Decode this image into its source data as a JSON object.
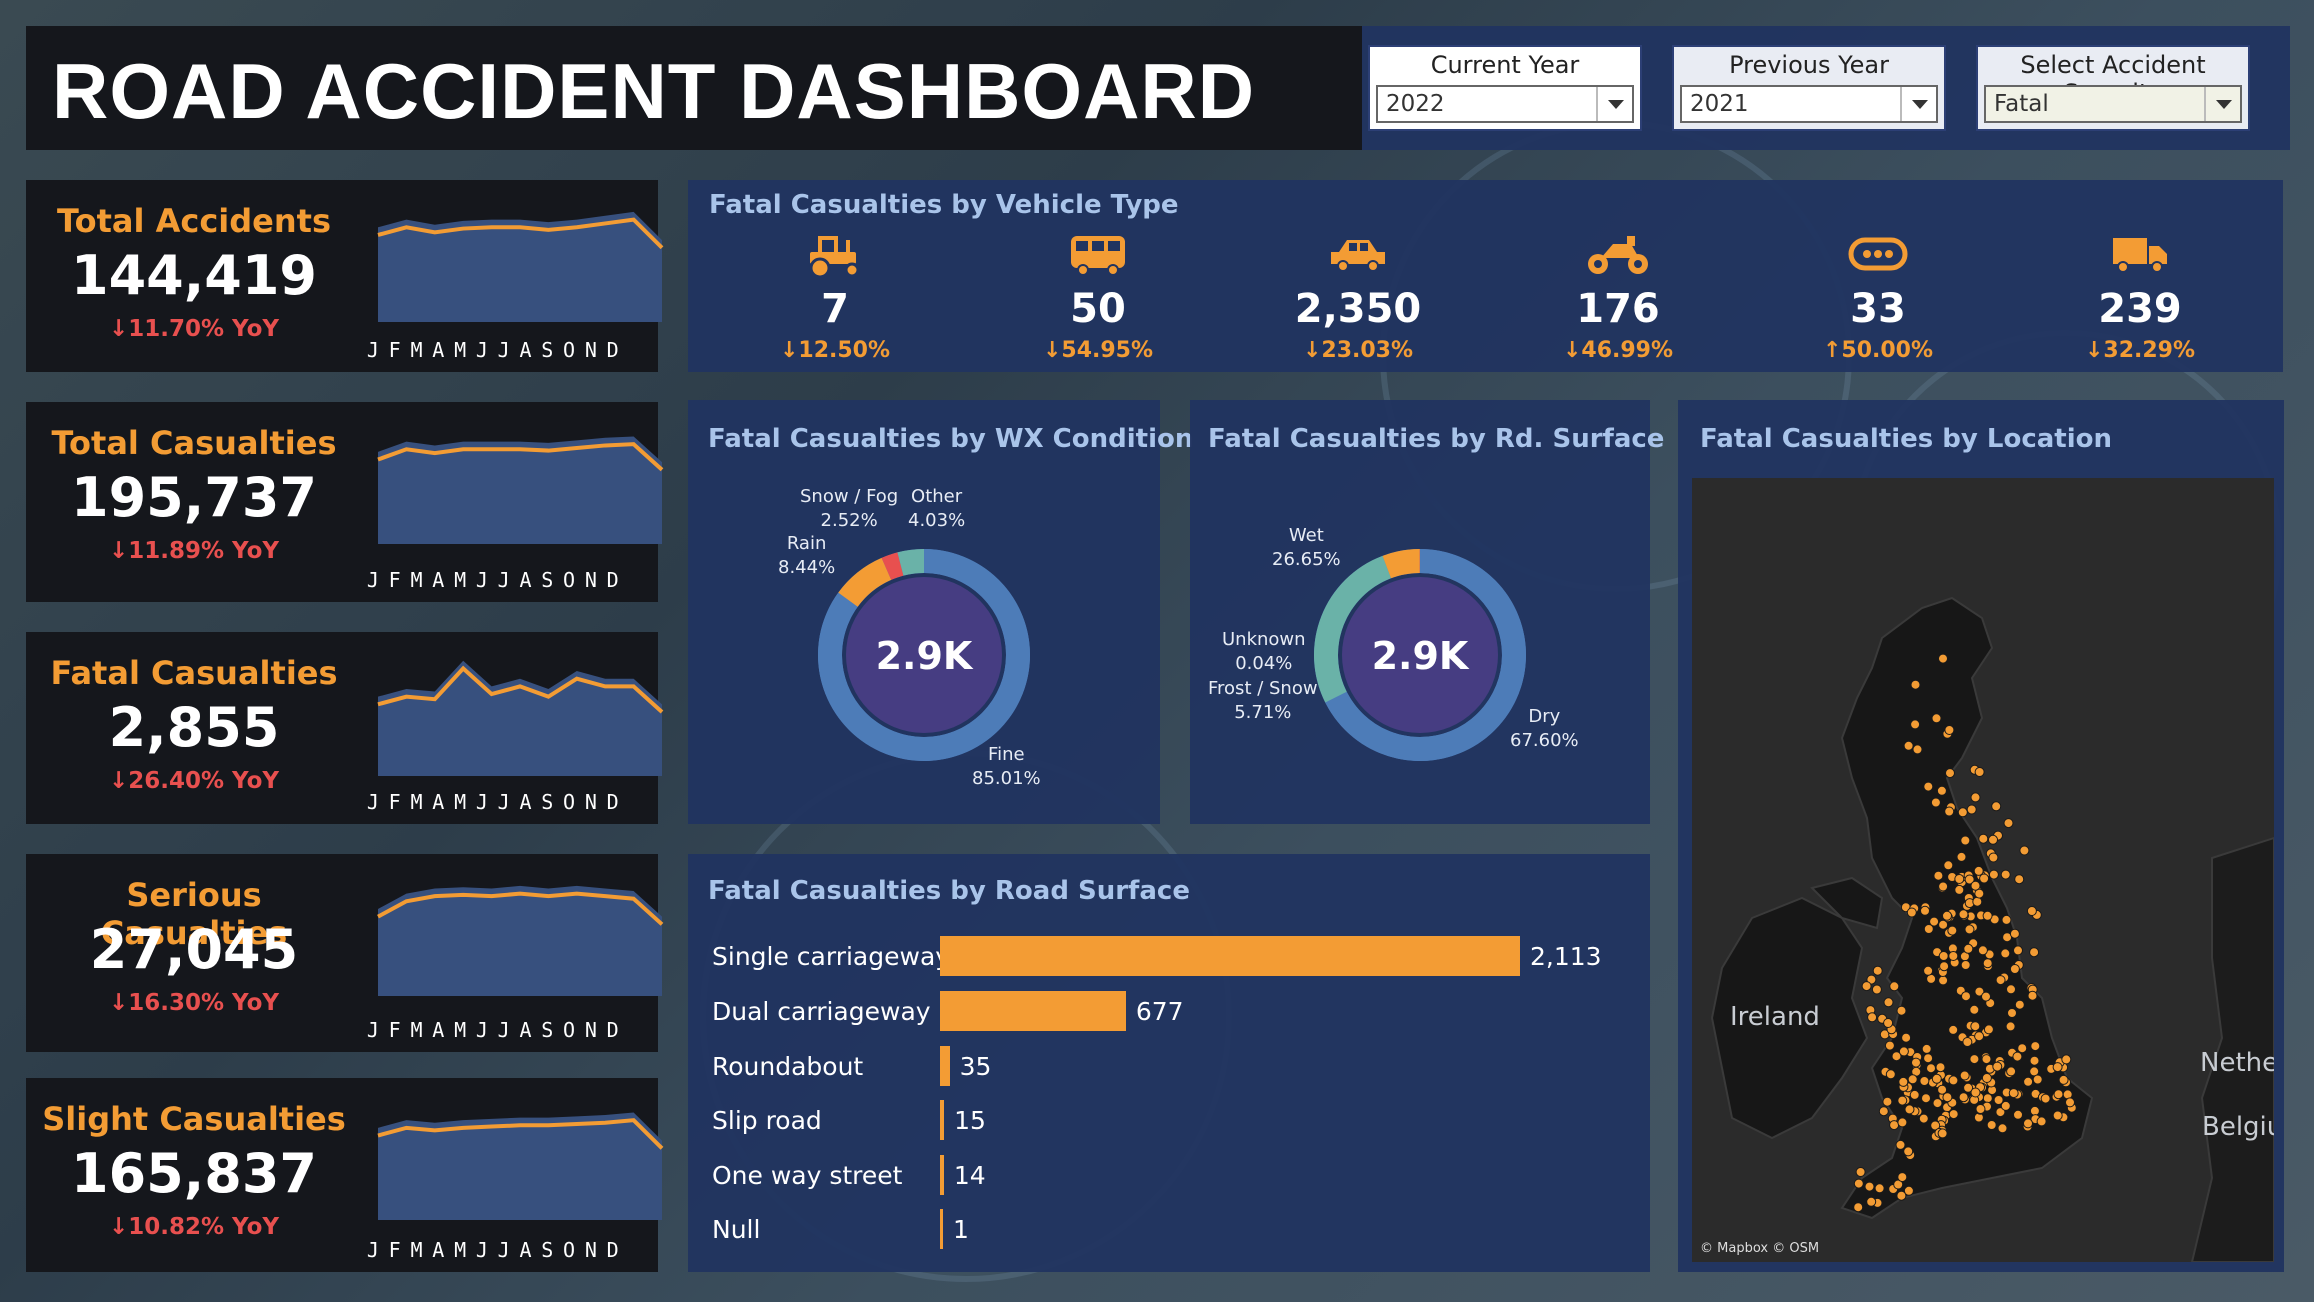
{
  "header": {
    "title": "ROAD ACCIDENT DASHBOARD",
    "filters": [
      {
        "label": "Current Year",
        "value": "2022"
      },
      {
        "label": "Previous Year",
        "value": "2021"
      },
      {
        "label": "Select Accident Severity",
        "value": "Fatal"
      }
    ]
  },
  "kpis": [
    {
      "title": "Total Accidents",
      "value": "144,419",
      "yoy": "↓11.70% YoY",
      "trend": [
        68,
        74,
        70,
        73,
        74,
        74,
        72,
        74,
        77,
        80,
        58
      ],
      "months": [
        "J",
        "F",
        "M",
        "A",
        "M",
        "J",
        "J",
        "A",
        "S",
        "O",
        "N",
        "D"
      ]
    },
    {
      "title": "Total Casualties",
      "value": "195,737",
      "yoy": "↓11.89% YoY",
      "trend": [
        66,
        74,
        71,
        74,
        74,
        74,
        73,
        75,
        77,
        78,
        58
      ],
      "months": [
        "J",
        "F",
        "M",
        "A",
        "M",
        "J",
        "J",
        "A",
        "S",
        "O",
        "N",
        "D"
      ]
    },
    {
      "title": "Fatal Casualties",
      "value": "2,855",
      "yoy": "↓26.40% YoY",
      "trend": [
        56,
        62,
        60,
        84,
        64,
        70,
        62,
        76,
        70,
        70,
        50
      ],
      "months": [
        "J",
        "F",
        "M",
        "A",
        "M",
        "J",
        "J",
        "A",
        "S",
        "O",
        "N",
        "D"
      ]
    },
    {
      "title": "Serious Casualties",
      "value": "27,045",
      "yoy": "↓16.30% YoY",
      "trend": [
        62,
        74,
        78,
        79,
        78,
        80,
        78,
        80,
        78,
        76,
        56
      ],
      "months": [
        "J",
        "F",
        "M",
        "A",
        "M",
        "J",
        "J",
        "A",
        "S",
        "O",
        "N",
        "D"
      ]
    },
    {
      "title": "Slight Casualties",
      "value": "165,837",
      "yoy": "↓10.82% YoY",
      "trend": [
        66,
        72,
        70,
        72,
        73,
        74,
        74,
        75,
        76,
        78,
        56
      ],
      "months": [
        "J",
        "F",
        "M",
        "A",
        "M",
        "J",
        "J",
        "A",
        "S",
        "O",
        "N",
        "D"
      ]
    }
  ],
  "vehicle_panel": {
    "title": "Fatal Casualties by Vehicle Type",
    "items": [
      {
        "icon": "tractor-icon",
        "value": "7",
        "change": "↓12.50%"
      },
      {
        "icon": "bus-icon",
        "value": "50",
        "change": "↓54.95%"
      },
      {
        "icon": "car-icon",
        "value": "2,350",
        "change": "↓23.03%"
      },
      {
        "icon": "motorcycle-icon",
        "value": "176",
        "change": "↓46.99%"
      },
      {
        "icon": "other-vehicle-icon",
        "value": "33",
        "change": "↑50.00%"
      },
      {
        "icon": "truck-icon",
        "value": "239",
        "change": "↓32.29%"
      }
    ]
  },
  "wx_panel": {
    "title": "Fatal Casualties by WX Condition",
    "center": "2.9K",
    "labels": {
      "snow_fog": "Snow / Fog",
      "snow_fog_pct": "2.52%",
      "other": "Other",
      "other_pct": "4.03%",
      "rain": "Rain",
      "rain_pct": "8.44%",
      "fine": "Fine",
      "fine_pct": "85.01%"
    }
  },
  "surface_panel": {
    "title": "Fatal Casualties by Rd. Surface",
    "center": "2.9K",
    "labels": {
      "wet": "Wet",
      "wet_pct": "26.65%",
      "unknown": "Unknown",
      "unknown_pct": "0.04%",
      "frost": "Frost / Snow",
      "frost_pct": "5.71%",
      "dry": "Dry",
      "dry_pct": "67.60%"
    }
  },
  "road_panel": {
    "title": "Fatal Casualties by Road Surface"
  },
  "map_panel": {
    "title": "Fatal Casualties by Location",
    "labels": {
      "ireland": "Ireland",
      "nether": "Nethe",
      "belgium": "Belgiu"
    },
    "credit": "© Mapbox © OSM"
  },
  "colors": {
    "accent": "#f39c34",
    "negative": "#e8504f",
    "panel": "#213460",
    "donut_base": "#4d7cb8",
    "donut_center": "#463d82",
    "teal": "#6ab2a8"
  },
  "chart_data": [
    {
      "type": "pie",
      "title": "Fatal Casualties by WX Condition",
      "categories": [
        "Fine",
        "Rain",
        "Snow / Fog",
        "Other"
      ],
      "values": [
        85.01,
        8.44,
        2.52,
        4.03
      ],
      "center_label": "2.9K"
    },
    {
      "type": "pie",
      "title": "Fatal Casualties by Rd. Surface",
      "categories": [
        "Dry",
        "Wet",
        "Frost / Snow",
        "Unknown"
      ],
      "values": [
        67.6,
        26.65,
        5.71,
        0.04
      ],
      "center_label": "2.9K"
    },
    {
      "type": "bar",
      "title": "Fatal Casualties by Road Surface",
      "categories": [
        "Single carriageway",
        "Dual carriageway",
        "Roundabout",
        "Slip road",
        "One way street",
        "Null"
      ],
      "values": [
        2113,
        677,
        35,
        15,
        14,
        1
      ],
      "value_labels": [
        "2,113",
        "677",
        "35",
        "15",
        "14",
        "1"
      ]
    },
    {
      "type": "line",
      "title": "Total Accidents",
      "categories": [
        "J",
        "F",
        "M",
        "A",
        "M",
        "J",
        "J",
        "A",
        "S",
        "O",
        "N",
        "D"
      ],
      "values": [
        68,
        74,
        70,
        73,
        74,
        74,
        72,
        74,
        77,
        80,
        58
      ]
    },
    {
      "type": "line",
      "title": "Total Casualties",
      "categories": [
        "J",
        "F",
        "M",
        "A",
        "M",
        "J",
        "J",
        "A",
        "S",
        "O",
        "N",
        "D"
      ],
      "values": [
        66,
        74,
        71,
        74,
        74,
        74,
        73,
        75,
        77,
        78,
        58
      ]
    },
    {
      "type": "line",
      "title": "Fatal Casualties",
      "categories": [
        "J",
        "F",
        "M",
        "A",
        "M",
        "J",
        "J",
        "A",
        "S",
        "O",
        "N",
        "D"
      ],
      "values": [
        56,
        62,
        60,
        84,
        64,
        70,
        62,
        76,
        70,
        70,
        50
      ]
    },
    {
      "type": "line",
      "title": "Serious Casualties",
      "categories": [
        "J",
        "F",
        "M",
        "A",
        "M",
        "J",
        "J",
        "A",
        "S",
        "O",
        "N",
        "D"
      ],
      "values": [
        62,
        74,
        78,
        79,
        78,
        80,
        78,
        80,
        78,
        76,
        56
      ]
    },
    {
      "type": "line",
      "title": "Slight Casualties",
      "categories": [
        "J",
        "F",
        "M",
        "A",
        "M",
        "J",
        "J",
        "A",
        "S",
        "O",
        "N",
        "D"
      ],
      "values": [
        66,
        72,
        70,
        72,
        73,
        74,
        74,
        75,
        76,
        78,
        56
      ]
    }
  ]
}
